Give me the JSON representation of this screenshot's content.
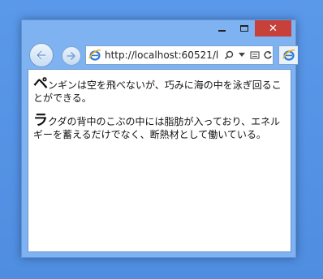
{
  "window": {
    "minimize_icon": "minimize-icon",
    "maximize_icon": "maximize-icon",
    "close_label": "✕"
  },
  "navigation": {
    "back_icon": "back-arrow-icon",
    "forward_icon": "forward-arrow-icon",
    "address": "http://localhost:60521/l",
    "site_icon": "ie-logo-icon",
    "tools": [
      "search-icon",
      "dropdown-icon",
      "compatibility-icon",
      "refresh-icon"
    ]
  },
  "content": {
    "paragraphs": [
      {
        "initial": "ペ",
        "text": "ンギンは空を飛べないが、巧みに海の中を泳ぎ回ることができる。"
      },
      {
        "initial": "ラ",
        "text": "クダの背中のこぶの中には脂肪が入っており、エネルギーを蓄えるだけでなく、断熱材として働いている。"
      }
    ]
  },
  "colors": {
    "desktop": "#4f8de0",
    "frame": "#7fb2f0",
    "close": "#c7403a"
  }
}
